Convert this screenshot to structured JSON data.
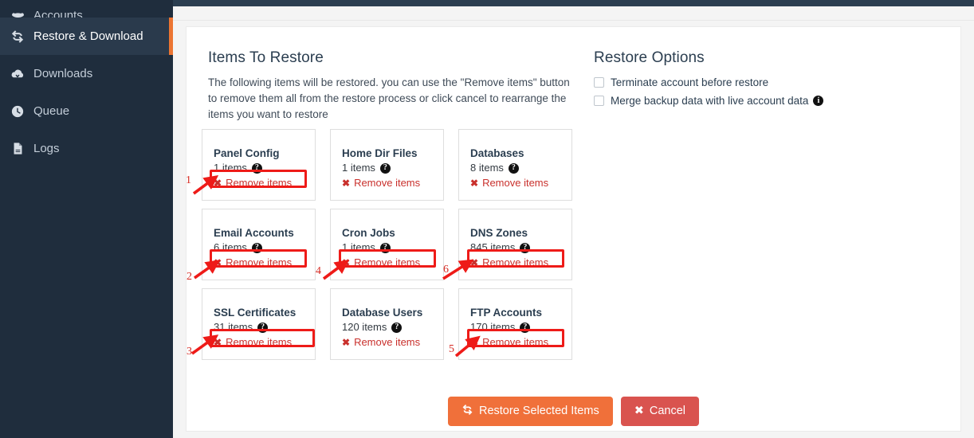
{
  "sidebar": {
    "items": [
      {
        "label": "Accounts",
        "icon": "users-icon",
        "active": false,
        "clipped": true
      },
      {
        "label": "Restore & Download",
        "icon": "refresh-sync-icon",
        "active": true,
        "clipped": false
      },
      {
        "label": "Downloads",
        "icon": "cloud-download-icon",
        "active": false,
        "clipped": false
      },
      {
        "label": "Queue",
        "icon": "clock-icon",
        "active": false,
        "clipped": false
      },
      {
        "label": "Logs",
        "icon": "file-text-icon",
        "active": false,
        "clipped": false
      }
    ],
    "background_color": "#1f2d3d",
    "active_accent_color": "#ec7532"
  },
  "main": {
    "items_to_restore": {
      "title": "Items To Restore",
      "description": "The following items will be restored. you can use the \"Remove items\" button to remove them all from the restore process or click cancel to rearrange the items you want to restore"
    },
    "restore_options": {
      "title": "Restore Options",
      "options": [
        {
          "label": "Terminate account before restore",
          "checked": false,
          "has_info": false
        },
        {
          "label": "Merge backup data with live account data",
          "checked": false,
          "has_info": true
        }
      ]
    },
    "cards": [
      {
        "title": "Panel Config",
        "count": "1 items",
        "remove_label": "Remove items",
        "highlighted": true,
        "annotation": "1"
      },
      {
        "title": "Home Dir Files",
        "count": "1 items",
        "remove_label": "Remove items",
        "highlighted": false,
        "annotation": ""
      },
      {
        "title": "Databases",
        "count": "8 items",
        "remove_label": "Remove items",
        "highlighted": false,
        "annotation": ""
      },
      {
        "title": "Email Accounts",
        "count": "6 items",
        "remove_label": "Remove items",
        "highlighted": true,
        "annotation": "2"
      },
      {
        "title": "Cron Jobs",
        "count": "1 items",
        "remove_label": "Remove items",
        "highlighted": true,
        "annotation": "4"
      },
      {
        "title": "DNS Zones",
        "count": "845 items",
        "remove_label": "Remove items",
        "highlighted": true,
        "annotation": "6"
      },
      {
        "title": "SSL Certificates",
        "count": "31 items",
        "remove_label": "Remove items",
        "highlighted": true,
        "annotation": "3"
      },
      {
        "title": "Database Users",
        "count": "120 items",
        "remove_label": "Remove items",
        "highlighted": false,
        "annotation": ""
      },
      {
        "title": "FTP Accounts",
        "count": "170 items",
        "remove_label": "Remove items",
        "highlighted": true,
        "annotation": "5"
      }
    ],
    "footer": {
      "restore_label": "Restore Selected Items",
      "cancel_label": "Cancel",
      "restore_color": "#f0703a",
      "cancel_color": "#d9534f"
    }
  },
  "annotations": {
    "marker_color": "#ee1b18",
    "numbers": [
      "1",
      "2",
      "3",
      "4",
      "5",
      "6"
    ]
  }
}
